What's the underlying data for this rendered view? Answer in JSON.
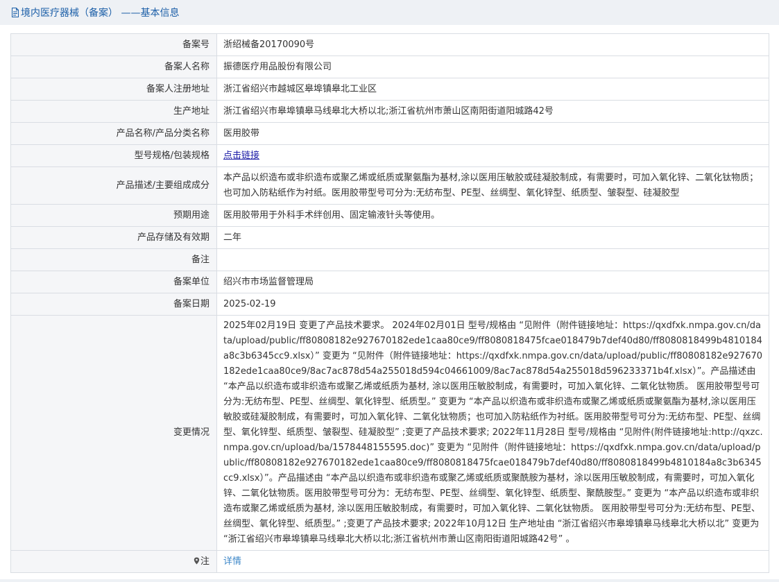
{
  "header": {
    "title": "境内医疗器械（备案） ——基本信息",
    "icon": "document-icon"
  },
  "rows": [
    {
      "label": "备案号",
      "value": "浙绍械备20170090号"
    },
    {
      "label": "备案人名称",
      "value": "振德医疗用品股份有限公司"
    },
    {
      "label": "备案人注册地址",
      "value": "浙江省绍兴市越城区皋埠镇皋北工业区"
    },
    {
      "label": "生产地址",
      "value": "浙江省绍兴市皋埠镇皋马线皋北大桥以北;浙江省杭州市萧山区南阳街道阳城路42号"
    },
    {
      "label": "产品名称/产品分类名称",
      "value": "医用胶带"
    },
    {
      "label": "型号规格/包装规格",
      "link": "点击链接"
    },
    {
      "label": "产品描述/主要组成成分",
      "value": "本产品以织造布或非织造布或聚乙烯或纸质或聚氨酯为基材,涂以医用压敏胶或硅凝胶制成，有需要时，可加入氧化锌、二氧化钛物质；也可加入防粘纸作为衬纸。医用胶带型号可分为:无纺布型、PE型、丝绸型、氧化锌型、纸质型、皱裂型、硅凝胶型"
    },
    {
      "label": "预期用途",
      "value": "医用胶带用于外科手术绊创用、固定输液针头等使用。"
    },
    {
      "label": "产品存储及有效期",
      "value": "二年"
    },
    {
      "label": "备注",
      "value": ""
    },
    {
      "label": "备案单位",
      "value": "绍兴市市场监督管理局"
    },
    {
      "label": "备案日期",
      "value": "2025-02-19"
    },
    {
      "label": "变更情况",
      "value": "2025年02月19日 变更了产品技术要求。 2024年02月01日 型号/规格由 “见附件（附件链接地址：https://qxdfxk.nmpa.gov.cn/data/upload/public/ff80808182e927670182ede1caa80ce9/ff8080818475fcae018479b7def40d80/ff8080818499b4810184a8c3b6345cc9.xlsx）” 变更为 “见附件（附件链接地址：https://qxdfxk.nmpa.gov.cn/data/upload/public/ff80808182e927670182ede1caa80ce9/8ac7ac878d54a255018d594c04661009/8ac7ac878d54a255018d596233371b4f.xlsx）”。产品描述由 “本产品以织造布或非织造布或聚乙烯或纸质为基材, 涂以医用压敏胶制成，有需要时，可加入氧化锌、二氧化钛物质。 医用胶带型号可分为:无纺布型、PE型、丝绸型、氧化锌型、纸质型。” 变更为 “本产品以织造布或非织造布或聚乙烯或纸质或聚氨酯为基材,涂以医用压敏胶或硅凝胶制成，有需要时，可加入氧化锌、二氧化钛物质；也可加入防粘纸作为衬纸。医用胶带型号可分为:无纺布型、PE型、丝绸型、氧化锌型、纸质型、皱裂型、硅凝胶型” ;变更了产品技术要求; 2022年11月28日 型号/规格由 “见附件(附件链接地址:http://qxzc.nmpa.gov.cn/upload/ba/1578448155595.doc)” 变更为 “见附件（附件链接地址：https://qxdfxk.nmpa.gov.cn/data/upload/public/ff80808182e927670182ede1caa80ce9/ff8080818475fcae018479b7def40d80/ff8080818499b4810184a8c3b6345cc9.xlsx）”。产品描述由 “本产品以织造布或非织造布或聚乙烯或纸质或聚酰胺为基材，涂以医用压敏胶制成，有需要时，可加入氧化锌、二氧化钛物质。医用胶带型号可分为：无纺布型、PE型、丝绸型、氧化锌型、纸质型、聚酰胺型。” 变更为 “本产品以织造布或非织造布或聚乙烯或纸质为基材, 涂以医用压敏胶制成，有需要时，可加入氧化锌、二氧化钛物质。 医用胶带型号可分为:无纺布型、PE型、丝绸型、氧化锌型、纸质型。” ;变更了产品技术要求; 2022年10月12日 生产地址由 “浙江省绍兴市皋埠镇皋马线皋北大桥以北” 变更为 “浙江省绍兴市皋埠镇皋马线皋北大桥以北;浙江省杭州市萧山区南阳街道阳城路42号” 。"
    },
    {
      "label": "注",
      "label_icon": "location-pin-icon",
      "link": "详情"
    }
  ]
}
